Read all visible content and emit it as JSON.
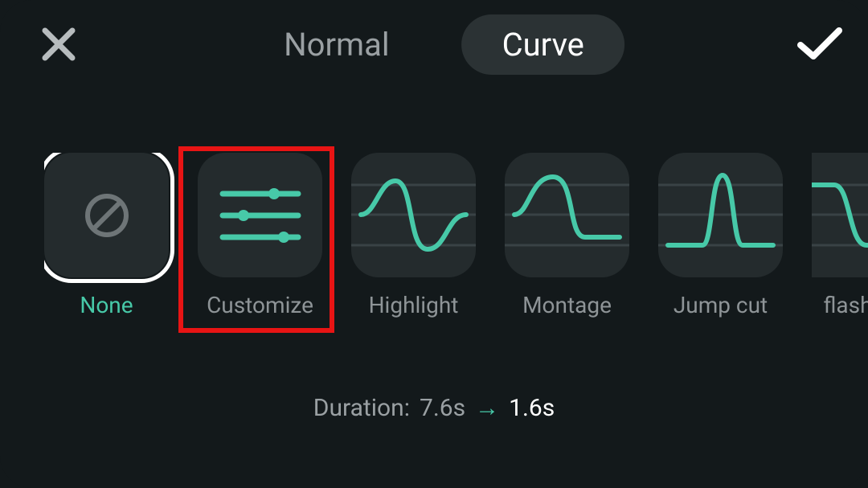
{
  "tabs": {
    "normal": "Normal",
    "curve": "Curve",
    "active": "curve"
  },
  "options": [
    {
      "key": "none",
      "label": "None",
      "icon": "none",
      "selected": true
    },
    {
      "key": "customize",
      "label": "Customize",
      "icon": "sliders",
      "selected": false,
      "annotated": true
    },
    {
      "key": "highlight",
      "label": "Highlight",
      "icon": "highlight",
      "selected": false
    },
    {
      "key": "montage",
      "label": "Montage",
      "icon": "montage",
      "selected": false
    },
    {
      "key": "jumpcut",
      "label": "Jump cut",
      "icon": "jumpcut",
      "selected": false
    },
    {
      "key": "flash",
      "label": "flash",
      "icon": "flash",
      "selected": false
    }
  ],
  "duration": {
    "prefix": "Duration:",
    "before": "7.6s",
    "after": "1.6s"
  },
  "colors": {
    "accent": "#47c9a8",
    "highlight_box": "#e81414"
  }
}
